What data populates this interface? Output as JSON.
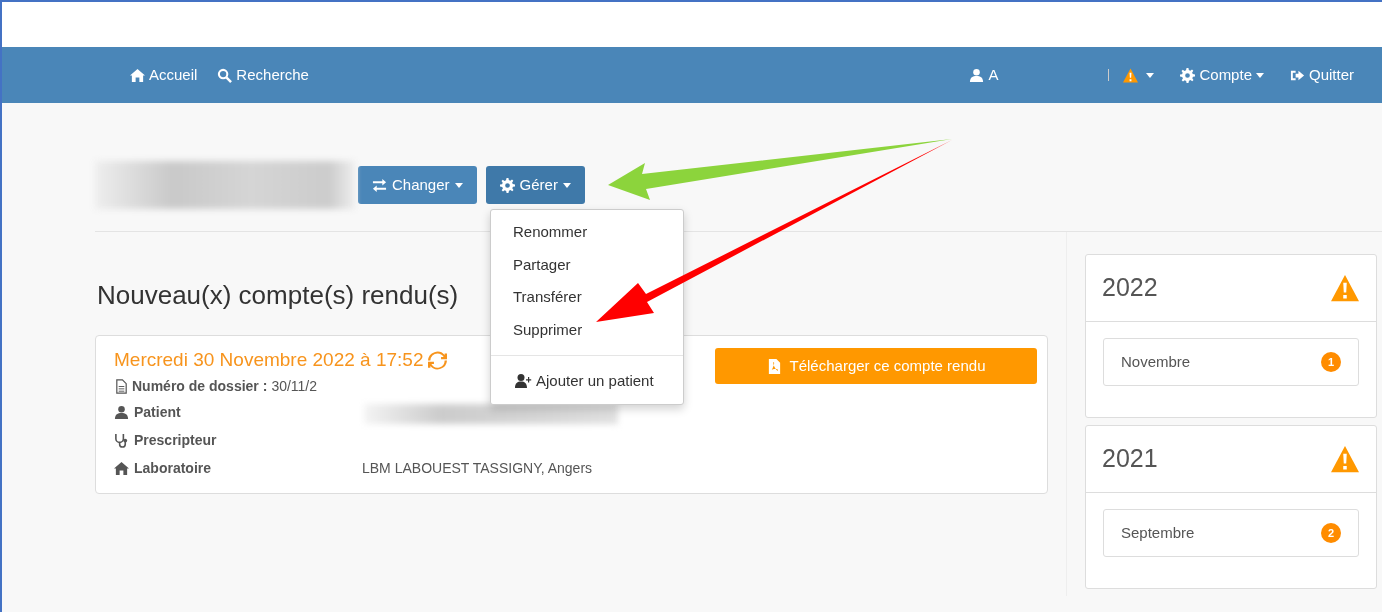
{
  "navbar": {
    "left": [
      {
        "label": "Accueil"
      },
      {
        "label": "Recherche"
      }
    ],
    "user": {
      "label": "A"
    },
    "right": [
      {
        "kind": "alert"
      },
      {
        "kind": "menu",
        "label": "Compte"
      },
      {
        "kind": "link",
        "label": "Quitter"
      }
    ]
  },
  "toolbar": {
    "buttons": [
      {
        "label": "Changer",
        "expanded": false
      },
      {
        "label": "Gérer",
        "expanded": true
      }
    ]
  },
  "menu": {
    "items": [
      {
        "kind": "option",
        "label": "Renommer"
      },
      {
        "kind": "option",
        "label": "Partager"
      },
      {
        "kind": "option",
        "label": "Transférer"
      },
      {
        "kind": "option",
        "label": "Supprimer"
      },
      {
        "kind": "action",
        "label": "Ajouter un patient"
      }
    ]
  },
  "section_title": "Nouveau(x) compte(s) rendu(s)",
  "report": {
    "date": "Mercredi 30 Novembre 2022 à 17:52",
    "dossier_label": "Numéro de dossier :",
    "dossier_value": "30/11/2",
    "fields": [
      {
        "label": "Patient"
      },
      {
        "label": "Prescripteur"
      },
      {
        "label": "Laboratoire",
        "value": "LBM LABOUEST TASSIGNY, Angers"
      }
    ],
    "download": "Télécharger ce compte rendu"
  },
  "years": [
    {
      "year": "2022",
      "months": [
        {
          "name": "Novembre",
          "count": "1"
        }
      ]
    },
    {
      "year": "2021",
      "months": [
        {
          "name": "Septembre",
          "count": "2"
        }
      ]
    }
  ]
}
